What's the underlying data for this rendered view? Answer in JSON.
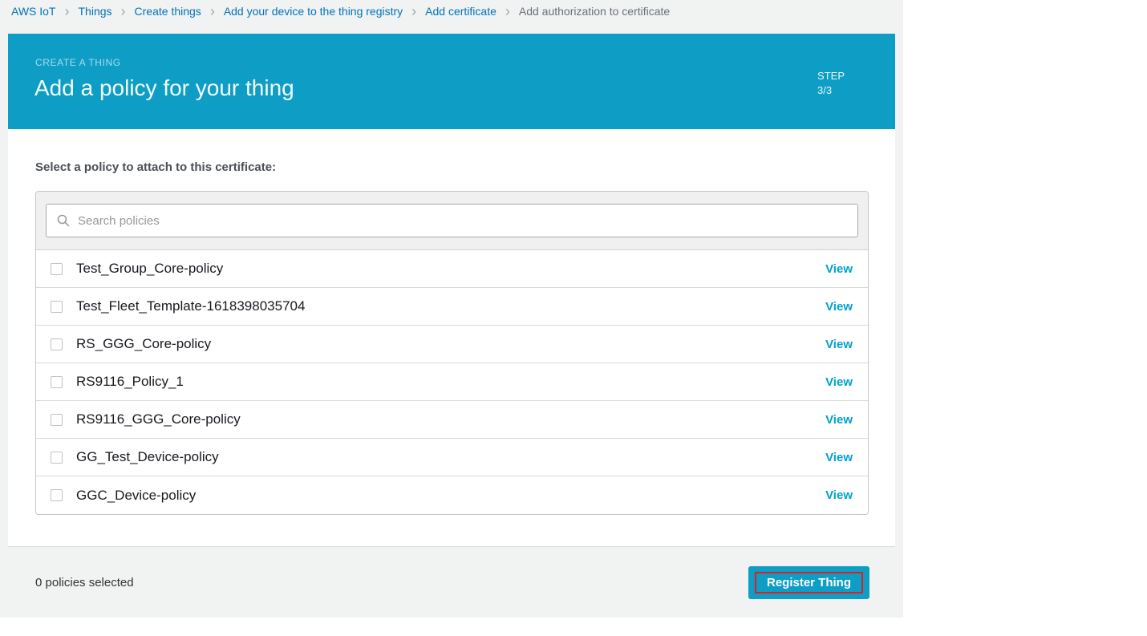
{
  "colors": {
    "accent-teal": "#0d9dc5",
    "link-blue": "#0073bb",
    "view-link": "#00a1c9",
    "annotation-red": "#de2020",
    "page-bg": "#f1f2f2"
  },
  "breadcrumb": {
    "items": [
      "AWS IoT",
      "Things",
      "Create things",
      "Add your device to the thing registry",
      "Add certificate",
      "Add authorization to certificate"
    ]
  },
  "header": {
    "kicker": "CREATE A THING",
    "title": "Add a policy for your thing",
    "step": {
      "label": "STEP",
      "value": "3/3"
    }
  },
  "main": {
    "section_label": "Select a policy to attach to this certificate:",
    "search": {
      "placeholder": "Search policies"
    },
    "view_label": "View",
    "policies": [
      {
        "name": "Test_Group_Core-policy",
        "checked": false
      },
      {
        "name": "Test_Fleet_Template-1618398035704",
        "checked": false
      },
      {
        "name": "RS_GGG_Core-policy",
        "checked": false
      },
      {
        "name": "RS9116_Policy_1",
        "checked": false
      },
      {
        "name": "RS9116_GGG_Core-policy",
        "checked": false
      },
      {
        "name": "GG_Test_Device-policy",
        "checked": false
      },
      {
        "name": "GGC_Device-policy",
        "checked": false
      }
    ]
  },
  "footer": {
    "selection_summary": "0 policies selected",
    "register_button": "Register Thing",
    "annotation": {
      "type": "red-highlight-box",
      "target": "register-button-label"
    }
  }
}
